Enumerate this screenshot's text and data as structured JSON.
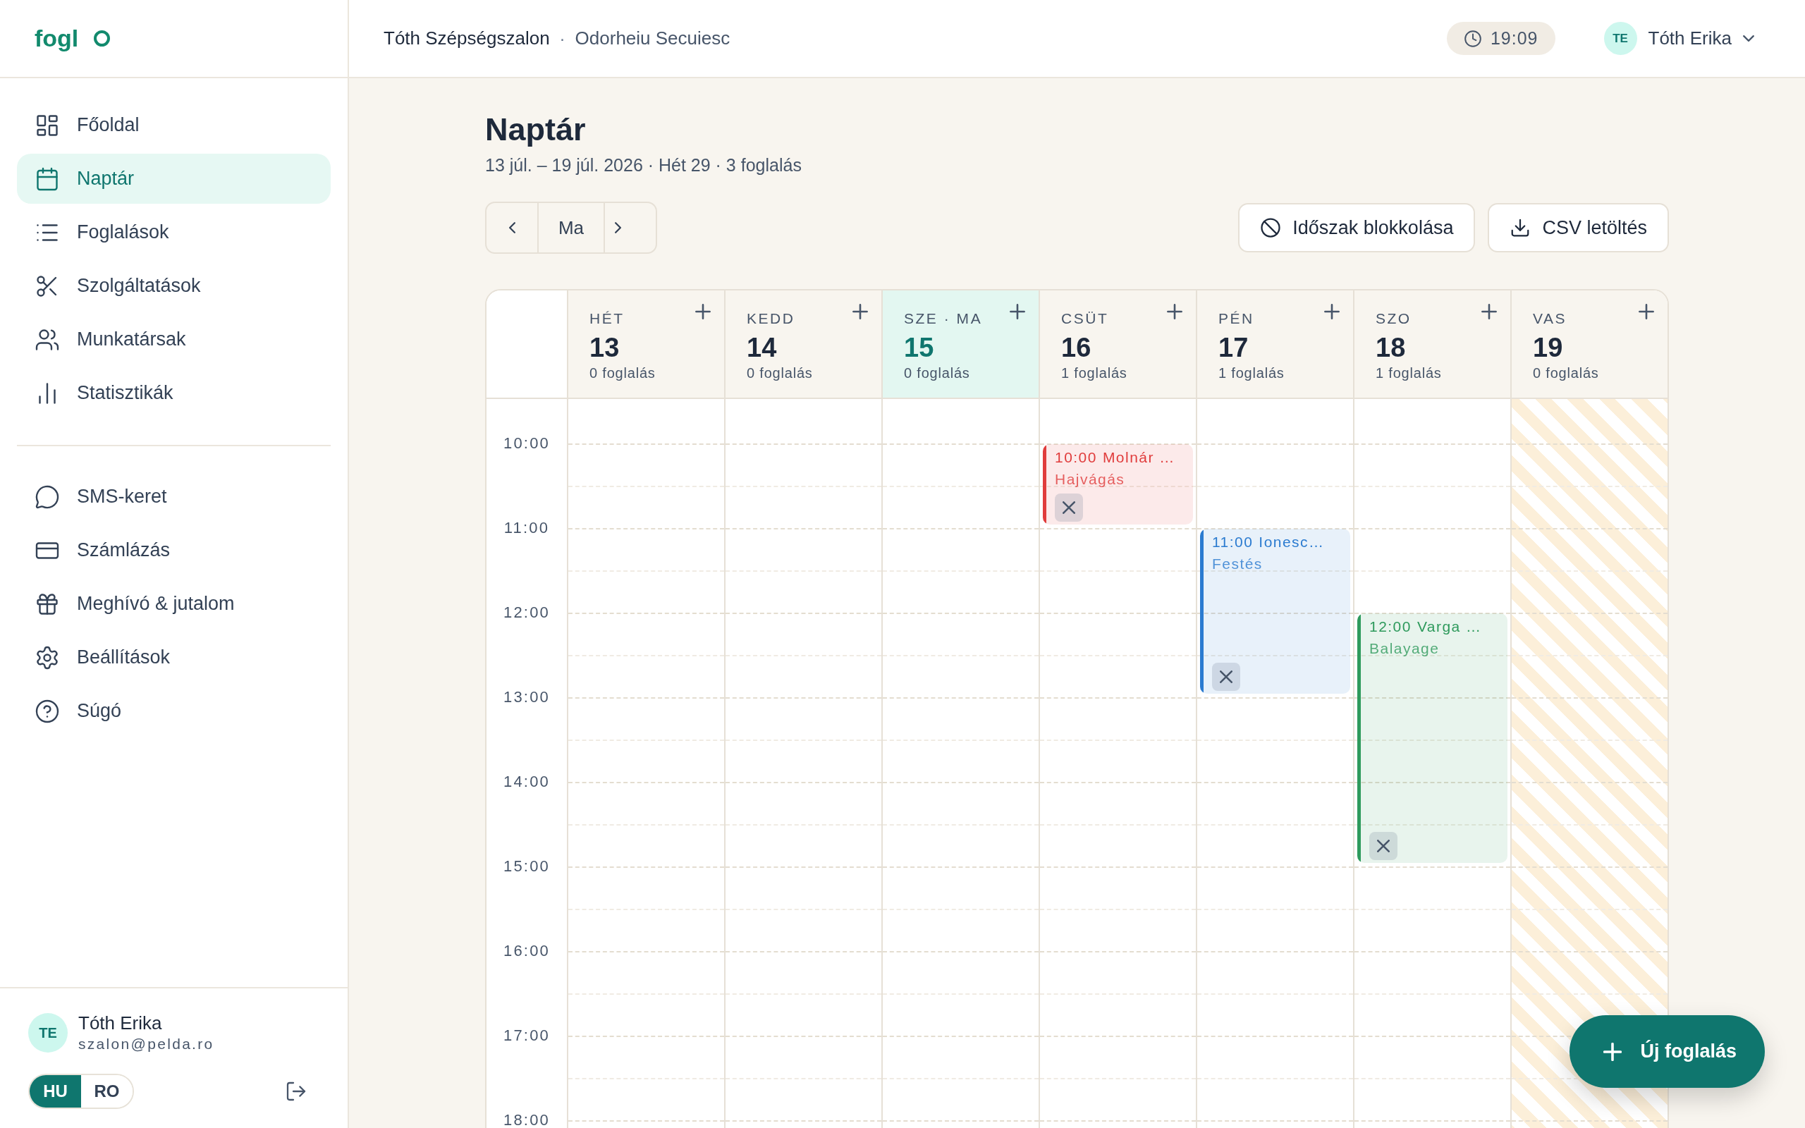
{
  "sidebar": {
    "logo": "fogl",
    "nav": [
      {
        "label": "Főoldal",
        "selected": false
      },
      {
        "label": "Naptár",
        "selected": true
      },
      {
        "label": "Foglalások",
        "selected": false
      },
      {
        "label": "Szolgáltatások",
        "selected": false
      },
      {
        "label": "Munkatársak",
        "selected": false
      },
      {
        "label": "Statisztikák",
        "selected": false
      }
    ],
    "nav_secondary": [
      {
        "label": "SMS-keret",
        "selected": false
      },
      {
        "label": "Számlázás",
        "selected": false
      },
      {
        "label": "Meghívó & jutalom",
        "selected": false
      },
      {
        "label": "Beállítások",
        "selected": false
      },
      {
        "label": "Súgó",
        "selected": false
      }
    ],
    "account": {
      "initials": "TE",
      "name": "Tóth Erika",
      "email": "szalon@pelda.ro"
    },
    "languages": [
      {
        "label": "HU",
        "selected": true
      },
      {
        "label": "RO",
        "selected": false
      }
    ]
  },
  "topbar": {
    "salon": "Tóth Szépségszalon",
    "separator": "·",
    "location": "Odorheiu Secuiesc",
    "time": "19:09",
    "user": {
      "initials": "TE",
      "name": "Tóth Erika"
    }
  },
  "page": {
    "title": "Naptár",
    "subtitle": "13 júl. – 19 júl. 2026 · Hét 29 · 3 foglalás",
    "today_button": "Ma",
    "actions": [
      {
        "label": "Időszak blokkolása"
      },
      {
        "label": "CSV letöltés"
      }
    ],
    "new_booking": "Új foglalás"
  },
  "calendar": {
    "hours": [
      "10:00",
      "11:00",
      "12:00",
      "13:00",
      "14:00",
      "15:00",
      "16:00",
      "17:00",
      "18:00"
    ],
    "days": [
      {
        "label": "HÉT",
        "date": "13",
        "count": "0 foglalás",
        "today": false,
        "closed": false
      },
      {
        "label": "KEDD",
        "date": "14",
        "count": "0 foglalás",
        "today": false,
        "closed": false
      },
      {
        "label": "SZE · MA",
        "date": "15",
        "count": "0 foglalás",
        "today": true,
        "closed": false
      },
      {
        "label": "CSÜT",
        "date": "16",
        "count": "1 foglalás",
        "today": false,
        "closed": false,
        "bookings": [
          {
            "time": "10:00",
            "client": "Molnár …",
            "service": "Hajvágás",
            "color": "#e03c3c",
            "kind": "one-hour"
          }
        ]
      },
      {
        "label": "PÉN",
        "date": "17",
        "count": "1 foglalás",
        "today": false,
        "closed": false,
        "bookings": [
          {
            "time": "11:00",
            "client": "Ionesc…",
            "service": "Festés",
            "color": "#2b7bd0",
            "kind": "two-hour"
          }
        ]
      },
      {
        "label": "SZO",
        "date": "18",
        "count": "1 foglalás",
        "today": false,
        "closed": false,
        "bookings": [
          {
            "time": "12:00",
            "client": "Varga …",
            "service": "Balayage",
            "color": "#2e9a5c",
            "kind": "three-hour"
          }
        ]
      },
      {
        "label": "VAS",
        "date": "19",
        "count": "0 foglalás",
        "today": false,
        "closed": true
      }
    ]
  }
}
